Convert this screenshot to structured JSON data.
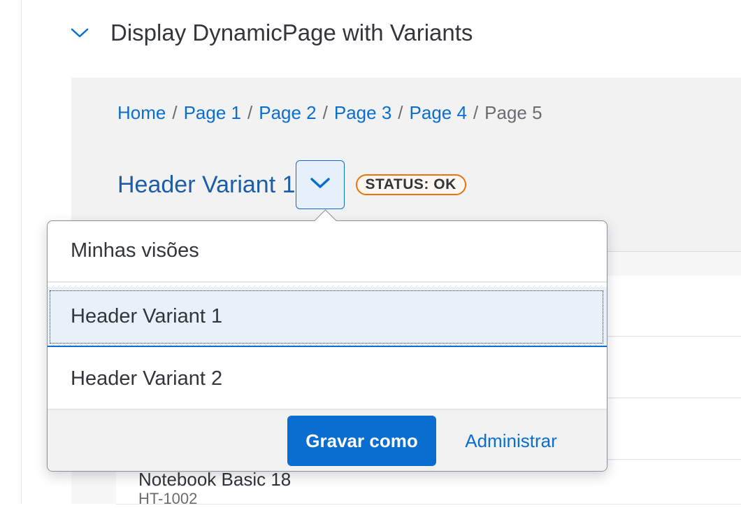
{
  "section": {
    "title": "Display DynamicPage with Variants"
  },
  "breadcrumb": {
    "links": [
      "Home",
      "Page 1",
      "Page 2",
      "Page 3",
      "Page 4"
    ],
    "separator": "/",
    "current": "Page 5"
  },
  "header": {
    "variant_title": "Header Variant 1",
    "status_badge": "STATUS: OK"
  },
  "popover": {
    "title": "Minhas visões",
    "items": [
      {
        "label": "Header Variant 1",
        "selected": true
      },
      {
        "label": "Header Variant 2",
        "selected": false
      }
    ],
    "save_as_label": "Gravar como",
    "manage_label": "Administrar"
  },
  "background_list": {
    "product_name": "Notebook Basic 18",
    "product_id": "HT-1002"
  },
  "colors": {
    "accent": "#0a6ed1",
    "title_blue": "#1d5ca7",
    "status_orange": "#e9730c",
    "selected_bg": "#e8f1fa"
  },
  "icons": {
    "section_toggle": "chevron-down-icon",
    "variant_dropdown": "chevron-down-icon"
  }
}
